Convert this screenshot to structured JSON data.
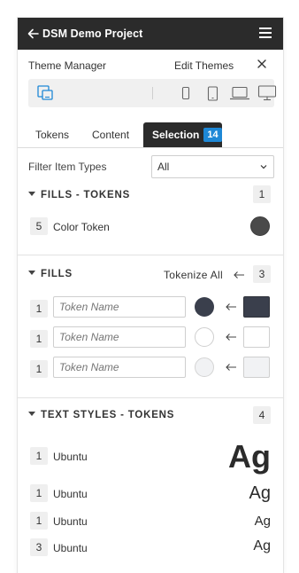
{
  "header": {
    "title": "DSM Demo Project"
  },
  "theme_manager": {
    "title": "Theme Manager",
    "edit_label": "Edit Themes"
  },
  "devices": [
    "tablet-linked-icon",
    "phone-icon",
    "tablet-icon",
    "laptop-icon",
    "monitor-icon"
  ],
  "tabs": [
    {
      "label": "Tokens"
    },
    {
      "label": "Content"
    },
    {
      "label": "Selection",
      "badge": "14",
      "active": true
    }
  ],
  "filter": {
    "label": "Filter Item Types",
    "value": "All"
  },
  "fills_tokens": {
    "title": "FILLS - TOKENS",
    "count": "1",
    "items": [
      {
        "count": "5",
        "name": "Color Token",
        "color": "#4a4a4a"
      }
    ]
  },
  "fills": {
    "title": "FILLS",
    "tokenize_label": "Tokenize All",
    "count": "3",
    "placeholder": "Token Name",
    "items": [
      {
        "count": "1",
        "color": "#3a3f4c"
      },
      {
        "count": "1",
        "color": "#ffffff"
      },
      {
        "count": "1",
        "color": "#f1f2f4"
      }
    ]
  },
  "text_styles": {
    "title": "TEXT STYLES - TOKENS",
    "count": "4",
    "sample": "Ag",
    "items": [
      {
        "count": "1",
        "font": "Ubuntu"
      },
      {
        "count": "1",
        "font": "Ubuntu"
      },
      {
        "count": "1",
        "font": "Ubuntu"
      },
      {
        "count": "3",
        "font": "Ubuntu"
      }
    ]
  },
  "colors": {
    "topbar": "#2b2b2b",
    "accent": "#1e88d6"
  }
}
